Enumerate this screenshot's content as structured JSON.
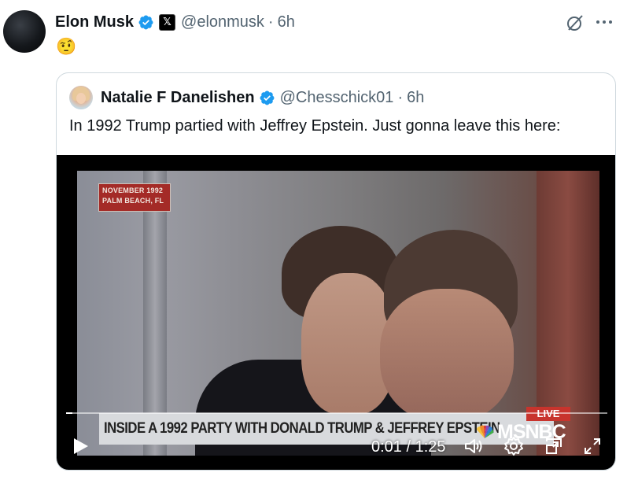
{
  "post": {
    "author_name": "Elon Musk",
    "affiliation_badge": "𝕏",
    "handle": "@elonmusk",
    "separator": "·",
    "time": "6h",
    "emoji": "🤨"
  },
  "quoted": {
    "author_name": "Natalie F Danelishen",
    "handle": "@Chesschick01",
    "separator": "·",
    "time": "6h",
    "text": "In 1992 Trump partied with Jeffrey Epstein. Just gonna leave this here:"
  },
  "video": {
    "date_badge_line1": "NOVEMBER 1992",
    "date_badge_line2": "PALM BEACH, FL",
    "lower_third": "INSIDE A 1992 PARTY WITH DONALD TRUMP & JEFFREY EPSTEIN",
    "live_label": "LIVE",
    "network": "MSNBC",
    "time_readout": "0:01 / 1:25",
    "progress_fraction": 0.012
  },
  "colors": {
    "verified": "#1d9bf0",
    "secondary_text": "#536471"
  },
  "icons": [
    "verified-icon",
    "grok-icon",
    "more-icon",
    "play-icon",
    "volume-icon",
    "settings-icon",
    "pip-icon",
    "fullscreen-icon"
  ]
}
